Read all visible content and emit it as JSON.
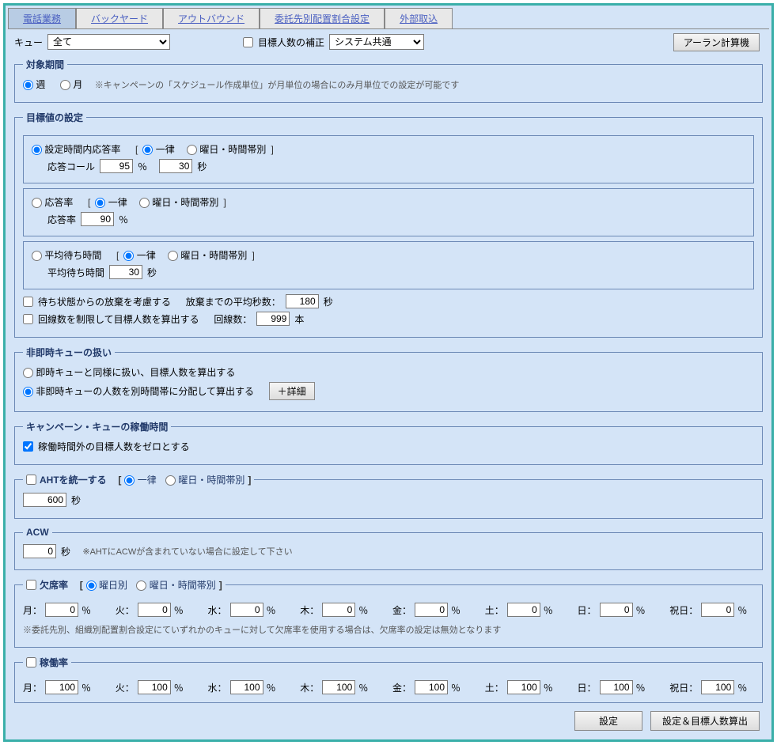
{
  "tabs": [
    "電話業務",
    "バックヤード",
    "アウトバウンド",
    "委託先別配置割合設定",
    "外部取込"
  ],
  "queue": {
    "label": "キュー",
    "value": "全て"
  },
  "correction": {
    "checkbox_label": "目標人数の補正",
    "value": "システム共通"
  },
  "erlang_btn": "アーラン計算機",
  "period": {
    "legend": "対象期間",
    "week": "週",
    "month": "月",
    "note": "※キャンペーンの「スケジュール作成単位」が月単位の場合にのみ月単位での設定が可能です"
  },
  "target": {
    "legend": "目標値の設定",
    "svc_level": "設定時間内応答率",
    "uniform": "一律",
    "by_day_time": "曜日・時間帯別",
    "answer_call": "応答コール",
    "val_pct": "95",
    "val_sec": "30",
    "pct": "％",
    "sec": "秒",
    "answer_rate": "応答率",
    "answer_rate_val": "90",
    "avg_wait": "平均待ち時間",
    "avg_wait_val": "30",
    "abandon_check": "待ち状態からの放棄を考慮する",
    "abandon_label": "放棄までの平均秒数：",
    "abandon_val": "180",
    "line_check": "回線数を制限して目標人数を算出する",
    "line_label": "回線数：",
    "line_val": "999",
    "line_unit": "本"
  },
  "nonreal": {
    "legend": "非即時キューの扱い",
    "opt1": "即時キューと同様に扱い、目標人数を算出する",
    "opt2": "非即時キューの人数を別時間帯に分配して算出する",
    "detail_btn": "＋詳細"
  },
  "operating": {
    "legend": "キャンペーン・キューの稼働時間",
    "check": "稼働時間外の目標人数をゼロとする"
  },
  "aht": {
    "legend": "AHTを統一する",
    "uniform": "一律",
    "by_day_time": "曜日・時間帯別",
    "value": "600",
    "sec": "秒"
  },
  "acw": {
    "legend": "ACW",
    "value": "0",
    "sec": "秒",
    "note": "※AHTにACWが含まれていない場合に設定して下さい"
  },
  "absence": {
    "legend": "欠席率",
    "by_day": "曜日別",
    "by_day_time": "曜日・時間帯別",
    "days": [
      "月：",
      "火：",
      "水：",
      "木：",
      "金：",
      "土：",
      "日：",
      "祝日："
    ],
    "values": [
      "0",
      "0",
      "0",
      "0",
      "0",
      "0",
      "0",
      "0"
    ],
    "pct": "％",
    "note": "※委託先別、組織別配置割合設定にていずれかのキューに対して欠席率を使用する場合は、欠席率の設定は無効となります"
  },
  "operation_rate": {
    "legend": "稼働率",
    "days": [
      "月：",
      "火：",
      "水：",
      "木：",
      "金：",
      "土：",
      "日：",
      "祝日："
    ],
    "values": [
      "100",
      "100",
      "100",
      "100",
      "100",
      "100",
      "100",
      "100"
    ],
    "pct": "％"
  },
  "footer": {
    "set": "設定",
    "set_calc": "設定＆目標人数算出"
  }
}
